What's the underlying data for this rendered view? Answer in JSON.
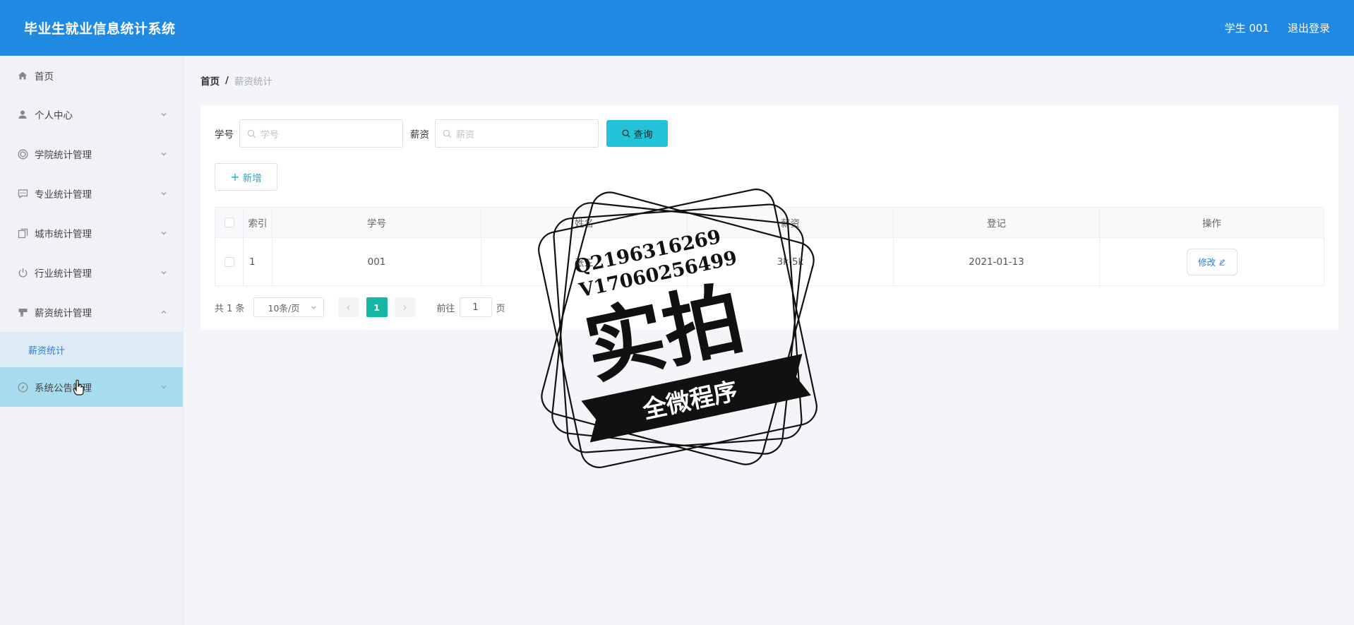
{
  "header": {
    "title": "毕业生就业信息统计系统",
    "user": "学生 001",
    "logout": "退出登录",
    "bg": "#2089e2"
  },
  "sidebar": {
    "items": [
      {
        "label": "首页",
        "icon": "home-icon"
      },
      {
        "label": "个人中心",
        "icon": "user-icon"
      },
      {
        "label": "学院统计管理",
        "icon": "circle-target-icon"
      },
      {
        "label": "专业统计管理",
        "icon": "chat-icon"
      },
      {
        "label": "城市统计管理",
        "icon": "copy-icon"
      },
      {
        "label": "行业统计管理",
        "icon": "power-icon"
      },
      {
        "label": "薪资统计管理",
        "icon": "stamp-icon"
      },
      {
        "label": "系统公告管理",
        "icon": "compass-icon"
      }
    ],
    "sub_item": "薪资统计"
  },
  "breadcrumb": {
    "home": "首页",
    "sep": "/",
    "current": "薪资统计"
  },
  "search": {
    "id_label": "学号",
    "id_placeholder": "学号",
    "salary_label": "薪资",
    "salary_placeholder": "薪资",
    "query_label": "查询"
  },
  "add_label": "新增",
  "table": {
    "columns": [
      "索引",
      "学号",
      "姓名",
      "薪资",
      "登记",
      "操作"
    ],
    "rows": [
      {
        "index": "1",
        "student_id": "001",
        "name": "张三",
        "salary": "3k-5k",
        "date": "2021-01-13",
        "action": "修改"
      }
    ]
  },
  "pager": {
    "total": "共 1 条",
    "page_size": "10条/页",
    "current": "1",
    "goto_label": "前往",
    "goto_value": "1",
    "page_unit": "页"
  },
  "watermark": {
    "line1": "Q2196316269",
    "line2": "V17060256499",
    "main": "实拍",
    "banner": "全微程序"
  }
}
